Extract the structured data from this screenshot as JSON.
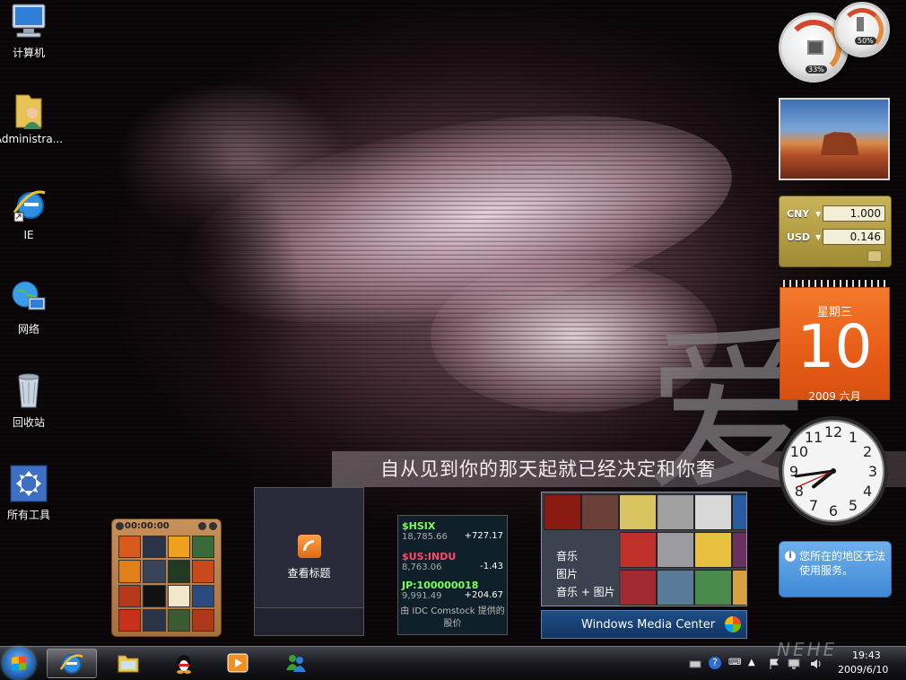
{
  "desktop": {
    "icons": [
      {
        "label": "计算机",
        "icon": "computer-icon"
      },
      {
        "label": "Administra...",
        "icon": "user-folder-icon"
      },
      {
        "label": "IE",
        "icon": "internet-explorer-icon"
      },
      {
        "label": "网络",
        "icon": "network-icon"
      },
      {
        "label": "回收站",
        "icon": "recycle-bin-icon"
      },
      {
        "label": "所有工具",
        "icon": "all-tools-icon"
      }
    ],
    "wallpaper_text": "自从见到你的那天起就已经决定和你奢",
    "wallpaper_glyph": "爱"
  },
  "gadgets": {
    "cpu_meter": {
      "cpu_percent": "33%",
      "memory_percent": "50%"
    },
    "currency": {
      "rows": [
        {
          "code": "CNY",
          "value": "1.000"
        },
        {
          "code": "USD",
          "value": "0.146"
        }
      ]
    },
    "calendar": {
      "weekday": "星期三",
      "day": "10",
      "year_month": "2009 六月"
    },
    "clock": {
      "hour": 7,
      "minute": 43,
      "second": 41
    },
    "weather": {
      "message": "您所在的地区无法使用服务。"
    },
    "puzzle": {
      "timer": "00:00:00"
    },
    "feeds": {
      "label": "查看标题"
    },
    "stocks": {
      "items": [
        {
          "symbol": "$HSIX",
          "price": "18,785.66",
          "change": "+727.17",
          "color": "#7bff5a"
        },
        {
          "symbol": "$US:INDU",
          "price": "8,763.06",
          "change": "-1.43",
          "color": "#ff4d6a"
        },
        {
          "symbol": "JP:100000018",
          "price": "9,991.49",
          "change": "+204.67",
          "color": "#7bff5a"
        }
      ],
      "source": "由 IDC Comstock 提供的股价"
    },
    "media_center": {
      "menu": [
        "音乐",
        "图片",
        "音乐 + 图片"
      ],
      "brand": "Windows Media Center"
    }
  },
  "taskbar": {
    "pinned": [
      {
        "name": "internet-explorer",
        "active": true
      },
      {
        "name": "windows-explorer",
        "active": false
      },
      {
        "name": "qq",
        "active": false
      },
      {
        "name": "media-player",
        "active": false
      },
      {
        "name": "messenger",
        "active": false
      }
    ],
    "time": "19:43",
    "date": "2009/6/10"
  },
  "watermark": "NEHE"
}
